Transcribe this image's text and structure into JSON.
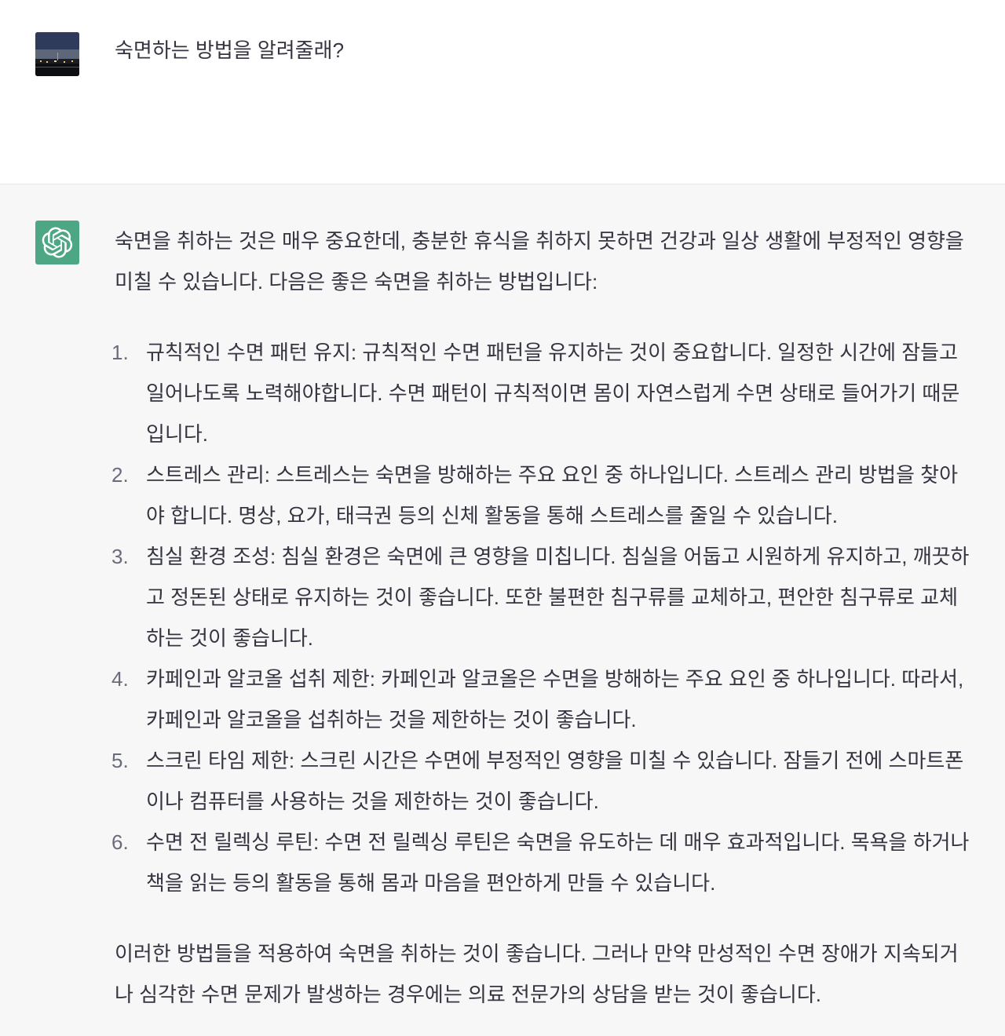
{
  "user_message": {
    "text": "숙면하는 방법을 알려줄래?"
  },
  "assistant_message": {
    "intro": "숙면을 취하는 것은 매우 중요한데, 충분한 휴식을 취하지 못하면 건강과 일상 생활에 부정적인 영향을 미칠 수 있습니다. 다음은 좋은 숙면을 취하는 방법입니다:",
    "items": [
      {
        "num": "1.",
        "text": "규칙적인 수면 패턴 유지: 규칙적인 수면 패턴을 유지하는 것이 중요합니다. 일정한 시간에 잠들고 일어나도록 노력해야합니다. 수면 패턴이 규칙적이면 몸이 자연스럽게 수면 상태로 들어가기 때문입니다."
      },
      {
        "num": "2.",
        "text": "스트레스 관리: 스트레스는 숙면을 방해하는 주요 요인 중 하나입니다. 스트레스 관리 방법을 찾아야 합니다. 명상, 요가, 태극권 등의 신체 활동을 통해 스트레스를 줄일 수 있습니다."
      },
      {
        "num": "3.",
        "text": "침실 환경 조성: 침실 환경은 숙면에 큰 영향을 미칩니다. 침실을 어둡고 시원하게 유지하고, 깨끗하고 정돈된 상태로 유지하는 것이 좋습니다. 또한 불편한 침구류를 교체하고, 편안한 침구류로 교체하는 것이 좋습니다."
      },
      {
        "num": "4.",
        "text": "카페인과 알코올 섭취 제한: 카페인과 알코올은 수면을 방해하는 주요 요인 중 하나입니다. 따라서, 카페인과 알코올을 섭취하는 것을 제한하는 것이 좋습니다."
      },
      {
        "num": "5.",
        "text": "스크린 타임 제한: 스크린 시간은 수면에 부정적인 영향을 미칠 수 있습니다. 잠들기 전에 스마트폰이나 컴퓨터를 사용하는 것을 제한하는 것이 좋습니다."
      },
      {
        "num": "6.",
        "text": "수면 전 릴렉싱 루틴: 수면 전 릴렉싱 루틴은 숙면을 유도하는 데 매우 효과적입니다. 목욕을 하거나 책을 읽는 등의 활동을 통해 몸과 마음을 편안하게 만들 수 있습니다."
      }
    ],
    "outro": "이러한 방법들을 적용하여 숙면을 취하는 것이 좋습니다. 그러나 만약 만성적인 수면 장애가 지속되거나 심각한 수면 문제가 발생하는 경우에는 의료 전문가의 상담을 받는 것이 좋습니다."
  },
  "icons": {
    "user_avatar": "user-avatar-photo",
    "assistant_avatar": "openai-logo-icon"
  },
  "colors": {
    "assistant_avatar_bg": "#4ea784",
    "assistant_row_bg": "#f7f7f8",
    "text": "#343541"
  }
}
